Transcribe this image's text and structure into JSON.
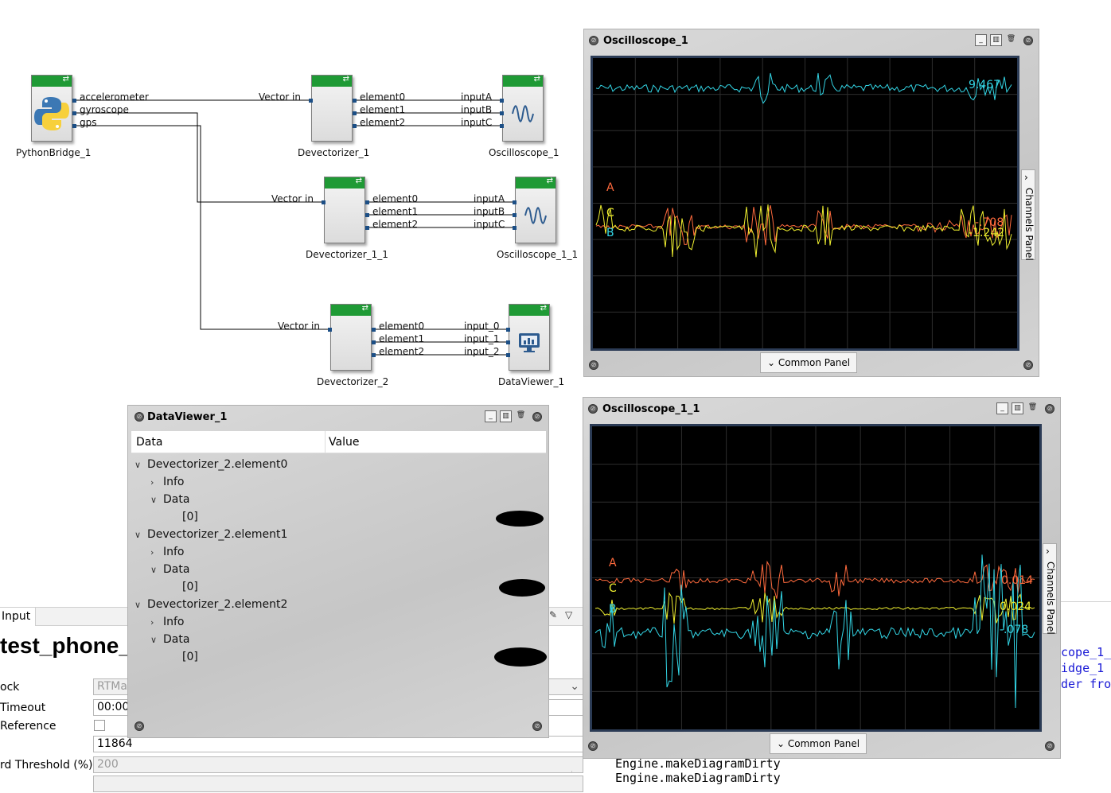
{
  "diagram": {
    "blocks": {
      "python_bridge": "PythonBridge_1",
      "devectorizer_1": "Devectorizer_1",
      "devectorizer_1_1": "Devectorizer_1_1",
      "devectorizer_2": "Devectorizer_2",
      "oscilloscope_1": "Oscilloscope_1",
      "oscilloscope_1_1": "Oscilloscope_1_1",
      "dataviewer_1": "DataViewer_1"
    },
    "ports": {
      "accelerometer": "accelerometer",
      "gyroscope": "gyroscope",
      "gps": "gps",
      "vector_in": "Vector in",
      "element0": "element0",
      "element1": "element1",
      "element2": "element2",
      "inputA": "inputA",
      "inputB": "inputB",
      "inputC": "inputC",
      "input_0": "input_0",
      "input_1": "input_1",
      "input_2": "input_2"
    }
  },
  "oscilloscope_top": {
    "title": "Oscilloscope_1",
    "common_panel": "Common Panel",
    "channels_panel": "Channels Panel",
    "value_upper": "9.467",
    "value_lower_1": "-.708",
    "value_lower_2": "-1.242",
    "marker_a": "A",
    "marker_c": "C",
    "marker_b": "B",
    "colors": {
      "a": "#ff6a3d",
      "b": "#33d6e6",
      "c": "#f0f030"
    }
  },
  "oscilloscope_bottom": {
    "title": "Oscilloscope_1_1",
    "common_panel": "Common Panel",
    "channels_panel": "Channels Panel",
    "value_a": "0.014",
    "value_c": "0.024",
    "value_b": "-.078",
    "marker_a": "A",
    "marker_c": "C",
    "marker_b": "B"
  },
  "dataviewer": {
    "title": "DataViewer_1",
    "col_data": "Data",
    "col_value": "Value",
    "groups": [
      {
        "name": "Devectorizer_2.element0",
        "info": "Info",
        "data": "Data",
        "index": "[0]"
      },
      {
        "name": "Devectorizer_2.element1",
        "info": "Info",
        "data": "Data",
        "index": "[0]"
      },
      {
        "name": "Devectorizer_2.element2",
        "info": "Info",
        "data": "Data",
        "index": "[0]"
      }
    ]
  },
  "ide": {
    "tab_label": "Input",
    "title": "test_phone_",
    "rows": [
      {
        "label": "ock",
        "value": "RTMa"
      },
      {
        "label": "Timeout",
        "value": "00:00"
      },
      {
        "label": "Reference",
        "value": ""
      },
      {
        "label": "",
        "value": "11864"
      },
      {
        "label": "rd Threshold (%)",
        "value": "200"
      }
    ],
    "console": [
      "Engine.makeDiagramDirty",
      "Engine.makeDiagramDirty"
    ],
    "code": [
      "cope_1_",
      "idge_1",
      "der fro"
    ]
  }
}
